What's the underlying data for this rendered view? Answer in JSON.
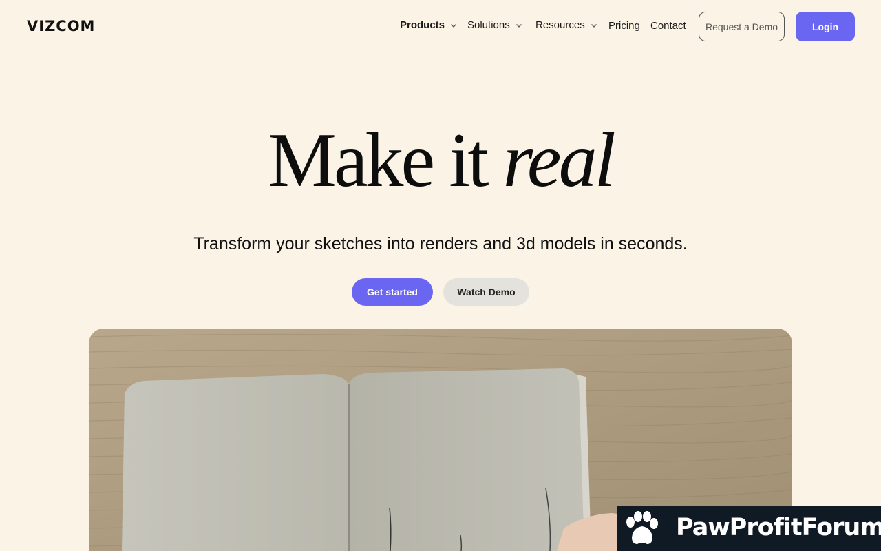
{
  "brand": {
    "logo_text": "VIZCOM"
  },
  "nav": {
    "items": [
      {
        "label": "Products",
        "has_dropdown": true
      },
      {
        "label": "Solutions",
        "has_dropdown": true
      },
      {
        "label": "Resources",
        "has_dropdown": true
      },
      {
        "label": "Pricing",
        "has_dropdown": false
      },
      {
        "label": "Contact",
        "has_dropdown": false
      }
    ],
    "request_demo_label": "Request a Demo",
    "login_label": "Login"
  },
  "hero": {
    "title_plain": "Make it ",
    "title_emphasis": "real",
    "subtitle": "Transform your sketches into renders and 3d models in seconds.",
    "primary_cta": "Get started",
    "secondary_cta": "Watch Demo"
  },
  "media": {
    "icon": "notebook-photo"
  },
  "watermark": {
    "text": "PawProfitForum",
    "icon": "paw-icon"
  },
  "colors": {
    "background": "#fbf4e6",
    "accent": "#6a66f2",
    "secondary_button": "#e4e2dc",
    "watermark_bg": "#101a24"
  }
}
